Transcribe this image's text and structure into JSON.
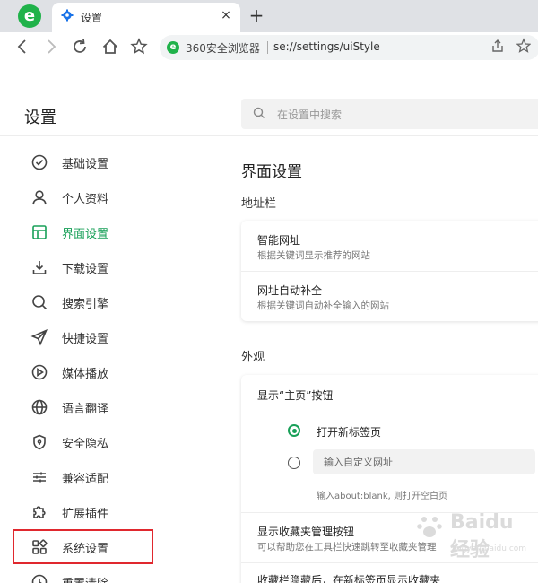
{
  "browser": {
    "tab_title": "设置",
    "tab_close": "×",
    "new_tab": "+",
    "omnibox_brand": "360安全浏览器",
    "omnibox_url": "se://settings/uiStyle",
    "logo_letter": "e"
  },
  "settings": {
    "title": "设置",
    "search_placeholder": "在设置中搜索",
    "sidebar": [
      {
        "label": "基础设置",
        "icon": "check-circle-icon"
      },
      {
        "label": "个人资料",
        "icon": "user-icon"
      },
      {
        "label": "界面设置",
        "icon": "layout-icon",
        "active": true
      },
      {
        "label": "下载设置",
        "icon": "download-icon"
      },
      {
        "label": "搜索引擎",
        "icon": "search-icon"
      },
      {
        "label": "快捷设置",
        "icon": "send-icon"
      },
      {
        "label": "媒体播放",
        "icon": "play-icon"
      },
      {
        "label": "语言翻译",
        "icon": "globe-icon"
      },
      {
        "label": "安全隐私",
        "icon": "shield-icon"
      },
      {
        "label": "兼容适配",
        "icon": "sliders-icon"
      },
      {
        "label": "扩展插件",
        "icon": "puzzle-icon"
      },
      {
        "label": "系统设置",
        "icon": "grid-icon"
      },
      {
        "label": "重置清除",
        "icon": "history-icon"
      }
    ],
    "section_title": "界面设置",
    "address_bar": {
      "label": "地址栏",
      "items": [
        {
          "title": "智能网址",
          "desc": "根据关键词显示推荐的网站"
        },
        {
          "title": "网址自动补全",
          "desc": "根据关键词自动补全输入的网站"
        }
      ]
    },
    "appearance": {
      "label": "外观",
      "home_button_title": "显示“主页”按钮",
      "radio_new_tab": "打开新标签页",
      "custom_url_placeholder": "输入自定义网址",
      "custom_url_hint": "输入about:blank, 则打开空白页",
      "bookmark_btn_title": "显示收藏夹管理按钮",
      "bookmark_btn_desc": "可以帮助您在工具栏快速跳转至收藏夹管理",
      "bookmark_hidden_title": "收藏栏隐藏后，在新标签页显示收藏夹"
    }
  },
  "watermark": {
    "text": "Baidu 经验",
    "sub": "jingyan.baidu.com"
  },
  "colors": {
    "accent": "#18a058",
    "highlight": "#e0282e",
    "brand": "#20b24a"
  }
}
